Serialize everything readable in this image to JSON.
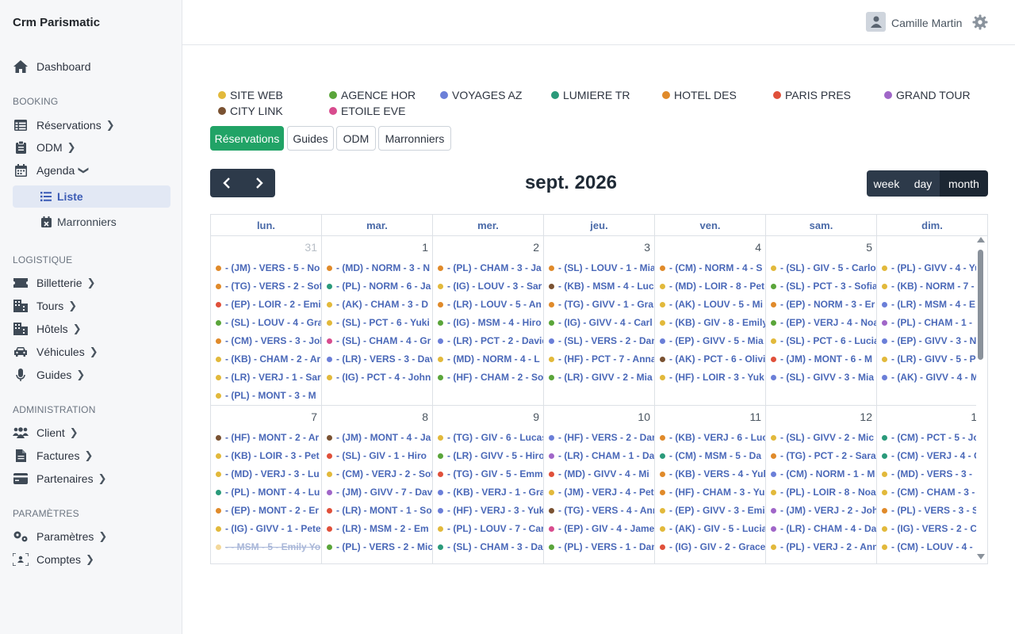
{
  "app": {
    "title": "Crm Parismatic"
  },
  "sidebar": {
    "dashboard": "Dashboard",
    "sections": {
      "booking": "BOOKING",
      "logistique": "LOGISTIQUE",
      "administration": "ADMINISTRATION",
      "parametres": "PARAMÈTRES"
    },
    "booking_items": {
      "reservations": "Réservations",
      "odm": "ODM",
      "agenda": "Agenda",
      "liste": "Liste",
      "marronniers": "Marronniers"
    },
    "logistique_items": {
      "billetterie": "Billetterie",
      "tours": "Tours",
      "hotels": "Hôtels",
      "vehicules": "Véhicules",
      "guides": "Guides"
    },
    "admin_items": {
      "client": "Client",
      "factures": "Factures",
      "partenaires": "Partenaires"
    },
    "param_items": {
      "parametres": "Paramètres",
      "comptes": "Comptes"
    }
  },
  "header": {
    "user_name": "Camille Martin"
  },
  "legend": [
    {
      "label": "SITE WEB",
      "color": "#e2b93b"
    },
    {
      "label": "AGENCE HOR",
      "color": "#5aa53a"
    },
    {
      "label": "VOYAGES AZ",
      "color": "#6b7fd8"
    },
    {
      "label": "LUMIERE TR",
      "color": "#2a9a7a"
    },
    {
      "label": "HOTEL DES",
      "color": "#e08a2a"
    },
    {
      "label": "PARIS PRES",
      "color": "#e0503a"
    },
    {
      "label": "GRAND TOUR",
      "color": "#a066c8"
    },
    {
      "label": "CITY LINK",
      "color": "#7a5232"
    },
    {
      "label": "ETOILE EVE",
      "color": "#d84c8e"
    }
  ],
  "tabs": [
    "Réservations",
    "Guides",
    "ODM",
    "Marronniers"
  ],
  "calendar": {
    "title": "sept. 2026",
    "views": [
      "week",
      "day",
      "month"
    ],
    "active_view": "month",
    "weekdays": [
      "lun.",
      "mar.",
      "mer.",
      "jeu.",
      "ven.",
      "sam.",
      "dim."
    ],
    "weeks": [
      {
        "days": [
          {
            "num": "31",
            "muted": true,
            "events": [
              {
                "t": "- (JM) - VERS - 5 - No",
                "c": "#e08a2a"
              },
              {
                "t": "- (TG) - VERS - 2 - Sof",
                "c": "#e08a2a"
              },
              {
                "t": "- (EP) - LOIR - 2 - Emi",
                "c": "#e0503a"
              },
              {
                "t": "- (SL) - LOUV - 4 - Gra",
                "c": "#5aa53a"
              },
              {
                "t": "- (CM) - VERS - 3 - Jol",
                "c": "#e08a2a"
              },
              {
                "t": "- (KB) - CHAM - 2 - Ar",
                "c": "#e2b93b"
              },
              {
                "t": "- (LR) - VERJ - 1 - Sara",
                "c": "#e2b93b"
              },
              {
                "t": "- (PL) - MONT - 3 - M",
                "c": "#e2b93b"
              }
            ]
          },
          {
            "num": "1",
            "events": [
              {
                "t": "- (MD) - NORM - 3 - N",
                "c": "#e08a2a"
              },
              {
                "t": "- (PL) - NORM - 6 - Ja",
                "c": "#2a9a7a"
              },
              {
                "t": "- (AK) - CHAM - 3 - D",
                "c": "#e2b93b"
              },
              {
                "t": "- (SL) - PCT - 6 - Yuki",
                "c": "#e2b93b"
              },
              {
                "t": "- (SL) - CHAM - 4 - Gr",
                "c": "#d84c8e"
              },
              {
                "t": "- (LR) - VERS - 3 - Dav",
                "c": "#6b7fd8"
              },
              {
                "t": "- (IG) - PCT - 4 - John",
                "c": "#e2b93b"
              }
            ]
          },
          {
            "num": "2",
            "events": [
              {
                "t": "- (PL) - CHAM - 3 - Ja",
                "c": "#e08a2a"
              },
              {
                "t": "- (IG) - LOUV - 3 - Sar",
                "c": "#e2b93b"
              },
              {
                "t": "- (LR) - LOUV - 5 - An",
                "c": "#e08a2a"
              },
              {
                "t": "- (IG) - MSM - 4 - Hiro",
                "c": "#5aa53a"
              },
              {
                "t": "- (LR) - PCT - 2 - David",
                "c": "#6b7fd8"
              },
              {
                "t": "- (MD) - NORM - 4 - L",
                "c": "#e2b93b"
              },
              {
                "t": "- (HF) - CHAM - 2 - So",
                "c": "#5aa53a"
              }
            ]
          },
          {
            "num": "3",
            "events": [
              {
                "t": "- (SL) - LOUV - 1 - Mia",
                "c": "#e08a2a"
              },
              {
                "t": "- (KB) - MSM - 4 - Luc",
                "c": "#7a5232"
              },
              {
                "t": "- (TG) - GIVV - 1 - Gra",
                "c": "#e08a2a"
              },
              {
                "t": "- (IG) - GIVV - 4 - Carl",
                "c": "#5aa53a"
              },
              {
                "t": "- (SL) - VERS - 2 - Dan",
                "c": "#6b7fd8"
              },
              {
                "t": "- (HF) - PCT - 7 - Anna",
                "c": "#e2b93b"
              },
              {
                "t": "- (LR) - GIVV - 2 - Mia",
                "c": "#5aa53a"
              }
            ]
          },
          {
            "num": "4",
            "events": [
              {
                "t": "- (CM) - NORM - 4 - S",
                "c": "#e08a2a"
              },
              {
                "t": "- (MD) - LOIR - 8 - Pet",
                "c": "#e2b93b"
              },
              {
                "t": "- (AK) - LOUV - 5 - Mi",
                "c": "#e2b93b"
              },
              {
                "t": "- (KB) - GIV - 8 - Emily",
                "c": "#e2b93b"
              },
              {
                "t": "- (EP) - GIVV - 5 - Mia",
                "c": "#6b7fd8"
              },
              {
                "t": "- (AK) - PCT - 6 - Olivi",
                "c": "#7a5232"
              },
              {
                "t": "- (HF) - LOIR - 3 - Yuk",
                "c": "#e2b93b"
              }
            ]
          },
          {
            "num": "5",
            "events": [
              {
                "t": "- (SL) - GIV - 5 - Carlo",
                "c": "#e2b93b"
              },
              {
                "t": "- (SL) - PCT - 3 - Sofia",
                "c": "#5aa53a"
              },
              {
                "t": "- (EP) - NORM - 3 - Er",
                "c": "#e08a2a"
              },
              {
                "t": "- (EP) - VERJ - 4 - Noa",
                "c": "#5aa53a"
              },
              {
                "t": "- (SL) - PCT - 6 - Lucia",
                "c": "#e2b93b"
              },
              {
                "t": "- (JM) - MONT - 6 - M",
                "c": "#e0503a"
              },
              {
                "t": "- (SL) - GIVV - 3 - Mia",
                "c": "#6b7fd8"
              }
            ]
          },
          {
            "num": "6",
            "events": [
              {
                "t": "- (PL) - GIVV - 4 - Yu",
                "c": "#e2b93b"
              },
              {
                "t": "- (KB) - NORM - 7 -",
                "c": "#e2b93b"
              },
              {
                "t": "- (LR) - MSM - 4 - E",
                "c": "#6b7fd8"
              },
              {
                "t": "- (PL) - CHAM - 1 -",
                "c": "#a066c8"
              },
              {
                "t": "- (EP) - GIVV - 3 - N",
                "c": "#6b7fd8"
              },
              {
                "t": "- (LR) - GIVV - 5 - P",
                "c": "#e2b93b"
              },
              {
                "t": "- (AK) - GIVV - 4 - M",
                "c": "#6b7fd8"
              }
            ]
          }
        ]
      },
      {
        "days": [
          {
            "num": "7",
            "events": [
              {
                "t": "- (HF) - MONT - 2 - Ar",
                "c": "#7a5232"
              },
              {
                "t": "- (KB) - LOIR - 3 - Pet",
                "c": "#e2b93b"
              },
              {
                "t": "- (MD) - VERJ - 3 - Lu",
                "c": "#e2b93b"
              },
              {
                "t": "- (PL) - MONT - 4 - Lu",
                "c": "#2a9a7a"
              },
              {
                "t": "- (EP) - MONT - 2 - Er",
                "c": "#e08a2a"
              },
              {
                "t": "- (IG) - GIVV - 1 - Pete",
                "c": "#e2b93b"
              },
              {
                "t": "- - MSM - 5 - Emily Yo",
                "c": "#f3d89a",
                "struck": true
              }
            ]
          },
          {
            "num": "8",
            "events": [
              {
                "t": "- (JM) - MONT - 4 - Ja",
                "c": "#7a5232"
              },
              {
                "t": "- (SL) - GIV - 1 - Hiro",
                "c": "#e0503a"
              },
              {
                "t": "- (CM) - VERJ - 2 - Sof",
                "c": "#e2b93b"
              },
              {
                "t": "- (JM) - GIVV - 7 - Dav",
                "c": "#a066c8"
              },
              {
                "t": "- (LR) - MONT - 1 - So",
                "c": "#e0503a"
              },
              {
                "t": "- (LR) - MSM - 2 - Em",
                "c": "#e0503a"
              },
              {
                "t": "- (PL) - VERS - 2 - Mic",
                "c": "#5aa53a"
              }
            ]
          },
          {
            "num": "9",
            "events": [
              {
                "t": "- (TG) - GIV - 6 - Lucas",
                "c": "#e2b93b"
              },
              {
                "t": "- (LR) - GIVV - 5 - Hiro",
                "c": "#5aa53a"
              },
              {
                "t": "- (TG) - GIV - 5 - Emm",
                "c": "#e0503a"
              },
              {
                "t": "- (KB) - VERJ - 1 - Gra",
                "c": "#6b7fd8"
              },
              {
                "t": "- (HF) - VERJ - 3 - Yuk",
                "c": "#6b7fd8"
              },
              {
                "t": "- (PL) - LOUV - 7 - Car",
                "c": "#e2b93b"
              },
              {
                "t": "- (SL) - CHAM - 3 - Da",
                "c": "#2a9a7a"
              }
            ]
          },
          {
            "num": "10",
            "events": [
              {
                "t": "- (HF) - VERS - 2 - Dan",
                "c": "#6b7fd8"
              },
              {
                "t": "- (LR) - CHAM - 1 - Da",
                "c": "#a066c8"
              },
              {
                "t": "- (MD) - GIVV - 4 - Mi",
                "c": "#e0503a"
              },
              {
                "t": "- (JM) - VERJ - 4 - Pet",
                "c": "#e2b93b"
              },
              {
                "t": "- (TG) - VERS - 4 - Ann",
                "c": "#7a5232"
              },
              {
                "t": "- (EP) - GIV - 4 - James",
                "c": "#d84c8e"
              },
              {
                "t": "- (PL) - VERS - 1 - Dan",
                "c": "#5aa53a"
              }
            ]
          },
          {
            "num": "11",
            "events": [
              {
                "t": "- (KB) - VERJ - 6 - Luc",
                "c": "#e08a2a"
              },
              {
                "t": "- (CM) - MSM - 5 - Da",
                "c": "#2a9a7a"
              },
              {
                "t": "- (KB) - VERS - 4 - Yuk",
                "c": "#e08a2a"
              },
              {
                "t": "- (HF) - CHAM - 3 - Yu",
                "c": "#e08a2a"
              },
              {
                "t": "- (EP) - GIVV - 3 - Emi",
                "c": "#e2b93b"
              },
              {
                "t": "- (AK) - GIV - 5 - Lucia",
                "c": "#e2b93b"
              },
              {
                "t": "- (IG) - GIV - 2 - Grace",
                "c": "#e0503a"
              }
            ]
          },
          {
            "num": "12",
            "events": [
              {
                "t": "- (SL) - GIVV - 2 - Mic",
                "c": "#e2b93b"
              },
              {
                "t": "- (TG) - PCT - 2 - Sara",
                "c": "#e08a2a"
              },
              {
                "t": "- (CM) - NORM - 1 - M",
                "c": "#6b7fd8"
              },
              {
                "t": "- (PL) - LOIR - 8 - Noa",
                "c": "#e2b93b"
              },
              {
                "t": "- (JM) - VERJ - 2 - Joh",
                "c": "#a066c8"
              },
              {
                "t": "- (LR) - CHAM - 4 - Da",
                "c": "#a066c8"
              },
              {
                "t": "- (PL) - VERJ - 2 - Ann",
                "c": "#e2b93b"
              }
            ]
          },
          {
            "num": "13",
            "events": [
              {
                "t": "- (CM) - PCT - 5 - Jo",
                "c": "#2a9a7a"
              },
              {
                "t": "- (CM) - VERJ - 4 - C",
                "c": "#2a9a7a"
              },
              {
                "t": "- (MD) - VERS - 3 -",
                "c": "#e2b93b"
              },
              {
                "t": "- (CM) - CHAM - 3 -",
                "c": "#e2b93b"
              },
              {
                "t": "- (PL) - VERS - 3 - S",
                "c": "#e08a2a"
              },
              {
                "t": "- (IG) - VERS - 2 - C",
                "c": "#e2b93b"
              },
              {
                "t": "- (CM) - LOUV - 4 -",
                "c": "#e2b93b"
              }
            ]
          }
        ]
      }
    ]
  }
}
